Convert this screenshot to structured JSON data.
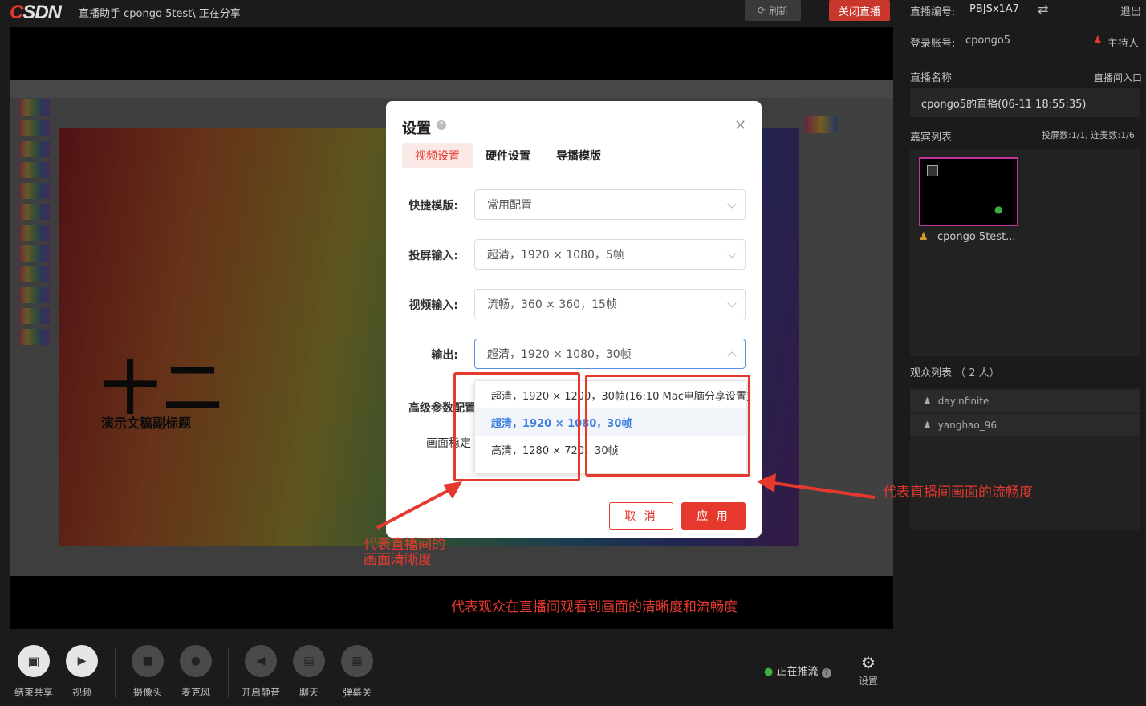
{
  "app": {
    "logo_c": "C",
    "logo_rest": "SDN",
    "title": "直播助手  cpongo 5test\\  正在分享",
    "refresh_label": "刷新",
    "close_live_label": "关闭直播"
  },
  "slide": {
    "title": "十二",
    "subtitle": "演示文稿副标题"
  },
  "side": {
    "live_id_label": "直播编号:",
    "live_id": "PBJSx1A7",
    "logout": "退出",
    "account_label": "登录账号:",
    "account": "cpongo5",
    "host_label": "主持人",
    "live_name_label": "直播名称",
    "live_entry": "直播间入口",
    "live_name": "cpongo5的直播(06-11 18:55:35)",
    "guest_list_label": "嘉宾列表",
    "guest_stats": "投屏数:1/1, 连麦数:1/6",
    "guest_name": "cpongo 5test...",
    "audience_label": "观众列表 （ 2 人）",
    "audience": [
      "dayinfinite",
      "yanghao_96"
    ]
  },
  "toolbar": {
    "items": [
      {
        "label": "结束共享",
        "icon": "screen-share-icon"
      },
      {
        "label": "视频",
        "icon": "play-icon"
      },
      {
        "label": "摄像头",
        "icon": "camera-icon"
      },
      {
        "label": "麦克风",
        "icon": "mic-icon"
      },
      {
        "label": "开启静音",
        "icon": "speaker-icon"
      },
      {
        "label": "聊天",
        "icon": "chat-icon"
      },
      {
        "label": "弹幕关",
        "icon": "danmaku-icon"
      }
    ],
    "streaming_status": "正在推流",
    "settings_label": "设置"
  },
  "modal": {
    "title": "设置",
    "tabs": [
      "视频设置",
      "硬件设置",
      "导播模版"
    ],
    "rows": [
      {
        "label": "快捷模版:",
        "value": "常用配置"
      },
      {
        "label": "投屏输入:",
        "value": "超清，1920 × 1080，5帧"
      },
      {
        "label": "视频输入:",
        "value": "流畅，360 × 360，15帧"
      },
      {
        "label": "输出:",
        "value": "超清，1920 × 1080，30帧"
      }
    ],
    "advanced_label": "高级参数配置",
    "stabilize_label": "画面稳定",
    "options": [
      "超清，1920 × 1200，30帧(16:10 Mac电脑分享设置)",
      "超清，1920 × 1080，30帧",
      "高清，1280 × 720，30帧"
    ],
    "cancel_label": "取 消",
    "apply_label": "应 用"
  },
  "annotations": {
    "clarity": "代表直播间的\n画面清晰度",
    "fluency": "代表直播间画面的流畅度",
    "summary": "代表观众在直播间观看到画面的清晰度和流畅度",
    "color": "#e5392e"
  }
}
